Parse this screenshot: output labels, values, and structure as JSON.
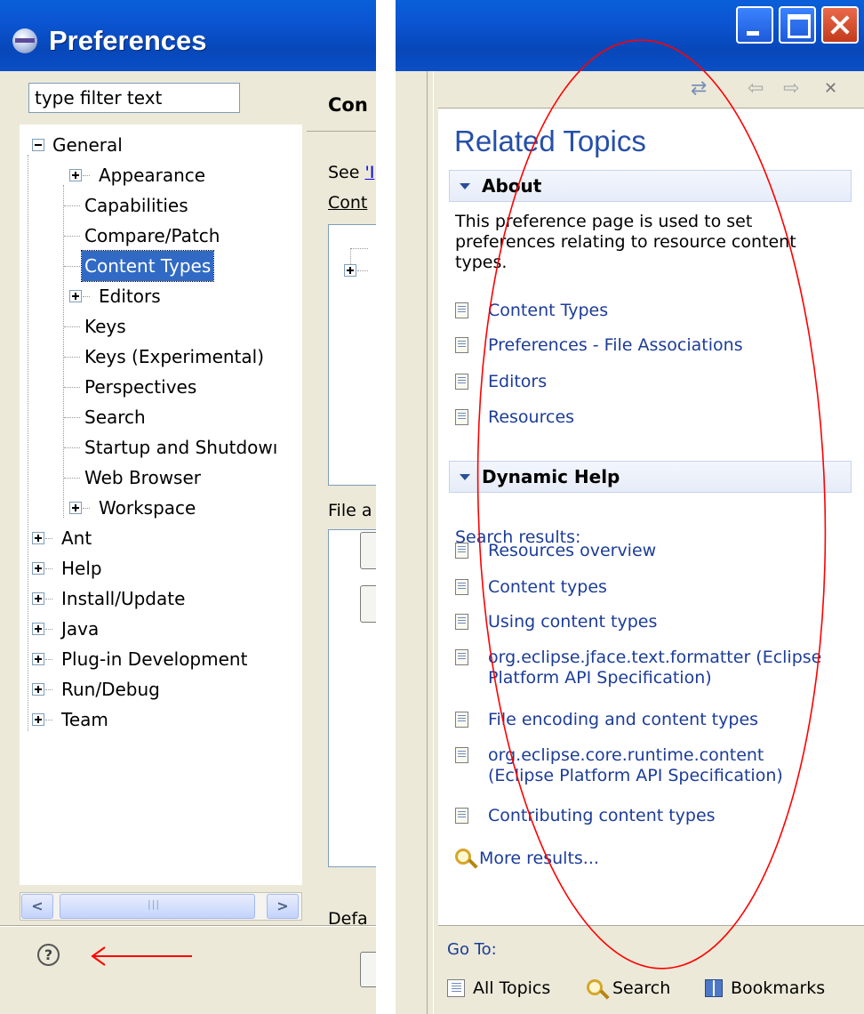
{
  "preferences_window": {
    "title": "Preferences",
    "filter": {
      "placeholder": "type filter text",
      "value": "type filter text"
    },
    "tree": {
      "items": [
        {
          "label": "General",
          "expander": "minus"
        },
        {
          "label": "Appearance",
          "expander": "plus"
        },
        {
          "label": "Capabilities"
        },
        {
          "label": "Compare/Patch"
        },
        {
          "label": "Content Types",
          "selected": true
        },
        {
          "label": "Editors",
          "expander": "plus"
        },
        {
          "label": "Keys"
        },
        {
          "label": "Keys (Experimental)"
        },
        {
          "label": "Perspectives"
        },
        {
          "label": "Search"
        },
        {
          "label": "Startup and Shutdowı"
        },
        {
          "label": "Web Browser"
        },
        {
          "label": "Workspace",
          "expander": "plus"
        },
        {
          "label": "Ant",
          "expander": "plus"
        },
        {
          "label": "Help",
          "expander": "plus"
        },
        {
          "label": "Install/Update",
          "expander": "plus"
        },
        {
          "label": "Java",
          "expander": "plus"
        },
        {
          "label": "Plug-in Development",
          "expander": "plus"
        },
        {
          "label": "Run/Debug",
          "expander": "plus"
        },
        {
          "label": "Team",
          "expander": "plus"
        }
      ]
    },
    "page": {
      "heading": "Con",
      "see_prefix": "See",
      "see_link": "'I",
      "content_label": "Cont",
      "file_label": "File a",
      "default_label": "Defa"
    },
    "scroll_left": "<",
    "scroll_right": ">",
    "help_button_label": "?",
    "arrow_color": "#ff0000"
  },
  "help_view": {
    "window_buttons": [
      "minimize",
      "maximize",
      "close"
    ],
    "toolbar_icons": [
      "sync-icon",
      "back-icon",
      "forward-icon",
      "close-icon"
    ],
    "title": "Related Topics",
    "about": {
      "header": "About",
      "description": "This preference page is used to set preferences relating to resource content types.",
      "links": [
        "Content Types",
        "Preferences - File Associations",
        "Editors",
        "Resources"
      ]
    },
    "dynamic_help": {
      "header": "Dynamic Help",
      "search_results_label": "Search results:",
      "results": [
        "Resources overview",
        "Content types",
        "Using content types",
        "org.eclipse.jface.text.formatter (Eclipse Platform API Specification)",
        "File encoding and content types",
        "org.eclipse.core.runtime.content (Eclipse Platform API Specification)",
        "Contributing content types"
      ],
      "more_results": "More results..."
    },
    "go_to": {
      "label": "Go To:",
      "items": [
        "All Topics",
        "Search",
        "Bookmarks"
      ]
    }
  },
  "colors": {
    "titlebar": "#0a55d3",
    "selection": "#316ac5",
    "link": "#1c3c98",
    "heading": "#2550a8",
    "annotation": "#ff0000",
    "window_bg": "#ece9d8"
  }
}
